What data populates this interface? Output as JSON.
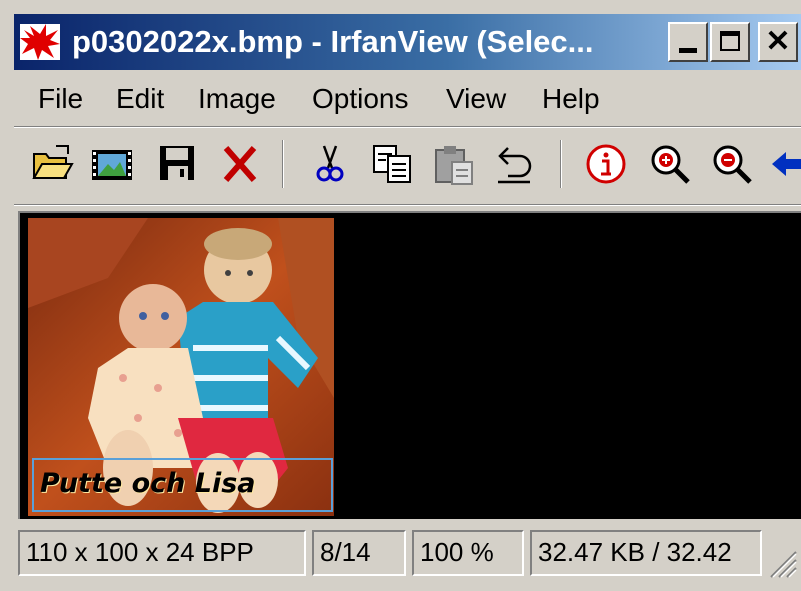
{
  "window": {
    "title": "p0302022x.bmp - IrfanView (Selec...",
    "controls": {
      "minimize": "minimize",
      "maximize": "maximize",
      "close": "close"
    }
  },
  "menu": {
    "items": [
      {
        "label": "File"
      },
      {
        "label": "Edit"
      },
      {
        "label": "Image"
      },
      {
        "label": "Options"
      },
      {
        "label": "View"
      },
      {
        "label": "Help"
      }
    ]
  },
  "toolbar": {
    "icons": [
      "open-folder-icon",
      "slideshow-icon",
      "save-icon",
      "delete-icon",
      "cut-icon",
      "copy-icon",
      "paste-icon",
      "undo-icon",
      "info-icon",
      "zoom-in-icon",
      "zoom-out-icon",
      "previous-icon"
    ]
  },
  "image": {
    "caption": "Putte och Lisa"
  },
  "status": {
    "dimensions": "110 x 100 x 24 BPP",
    "index": "8/14",
    "zoom": "100 %",
    "size": "32.47 KB / 32.42"
  },
  "colors": {
    "title_gradient_start": "#0a246a",
    "title_gradient_end": "#a6caf0",
    "chrome": "#d4d0c8",
    "canvas": "#000000",
    "selection": "#5aa0d8"
  }
}
